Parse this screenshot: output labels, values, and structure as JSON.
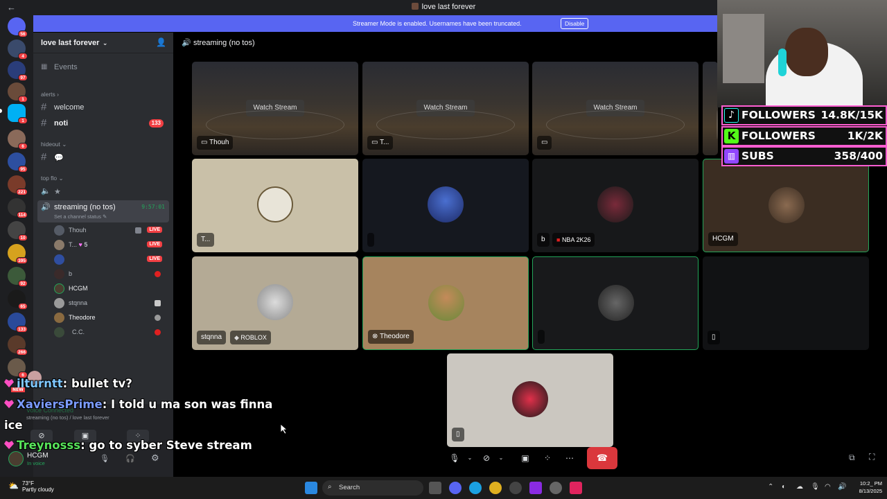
{
  "titlebar": {
    "title": "love last forever",
    "back": "←"
  },
  "banner": {
    "text": "Streamer Mode is enabled. Usernames have been truncated.",
    "button": "Disable"
  },
  "rail": {
    "badges": [
      "56",
      "4",
      "97",
      "1",
      "1",
      "6",
      "95",
      "221",
      "114",
      "10",
      "395",
      "92",
      "65",
      "133",
      "266",
      "6"
    ]
  },
  "sidebar": {
    "server_name": "love last forever",
    "events": "Events",
    "categories": {
      "alerts": "alerts ›",
      "hideout": "hideout ⌄",
      "top_flo": "top flo ⌄"
    },
    "channels": [
      {
        "name": "welcome"
      },
      {
        "name": "noti",
        "badge": "133"
      },
      {
        "name": "💬"
      }
    ],
    "voice_channel": {
      "name": "streaming (no tos)",
      "time": "9:57:01",
      "status": "Set a channel status ✎"
    },
    "star_channel": "★",
    "voice_users": [
      {
        "name": "Thouh",
        "live": "LIVE"
      },
      {
        "name": "T...",
        "extra": "5",
        "live": "LIVE"
      },
      {
        "name": "",
        "live": "LIVE"
      },
      {
        "name": "b"
      },
      {
        "name": "HCGM"
      },
      {
        "name": "stqnna"
      },
      {
        "name": "Theodore"
      },
      {
        "name": "C.C."
      }
    ]
  },
  "voice_panel": {
    "connected": "Voice Connected",
    "path": "streaming (no tos) / love last forever",
    "user": "HCGM",
    "user_status": "In voice"
  },
  "main": {
    "channel_title": "streaming (no tos)",
    "watch_label": "Watch Stream",
    "stream_tiles": [
      {
        "name": "Thouh"
      },
      {
        "name": "T..."
      },
      {
        "name": ""
      }
    ],
    "participants": [
      {
        "name": "T..."
      },
      {
        "name": ""
      },
      {
        "name": "b",
        "game": "NBA 2K26"
      },
      {
        "name": "HCGM"
      },
      {
        "name": "stqnna",
        "game": "ROBLOX"
      },
      {
        "name": "Theodore"
      },
      {
        "name": ""
      },
      {
        "name": ""
      },
      {
        "name": ""
      }
    ]
  },
  "chat": [
    {
      "user": "jlturntt",
      "message": "bullet tv?",
      "user_color": "#7fc8ff",
      "badge_new": "NEW"
    },
    {
      "user": "XaviersPrime",
      "message": "I told u ma son was finna",
      "continuation": "ice",
      "user_color": "#7b9bff"
    },
    {
      "user": "Treynosss",
      "message": "go to syber Steve stream",
      "user_color": "#57e35a"
    }
  ],
  "overlay_stats": [
    {
      "label": "FOLLOWERS",
      "value": "14.8K/15K",
      "icon": "tiktok-icon",
      "color": "#000000"
    },
    {
      "label": "FOLLOWERS",
      "value": "1K/2K",
      "icon": "kick-icon",
      "color": "#53fc18"
    },
    {
      "label": "SUBS",
      "value": "358/400",
      "icon": "twitch-icon",
      "color": "#9146ff"
    }
  ],
  "taskbar": {
    "temp": "73°F",
    "weather": "Partly cloudy",
    "search": "Search",
    "time": "10:2_ PM",
    "date": "8/13/2025"
  },
  "colors": {
    "accent": "#5865f2",
    "live": "#f23f43",
    "speaking": "#23a55a",
    "hangup": "#da373c"
  }
}
